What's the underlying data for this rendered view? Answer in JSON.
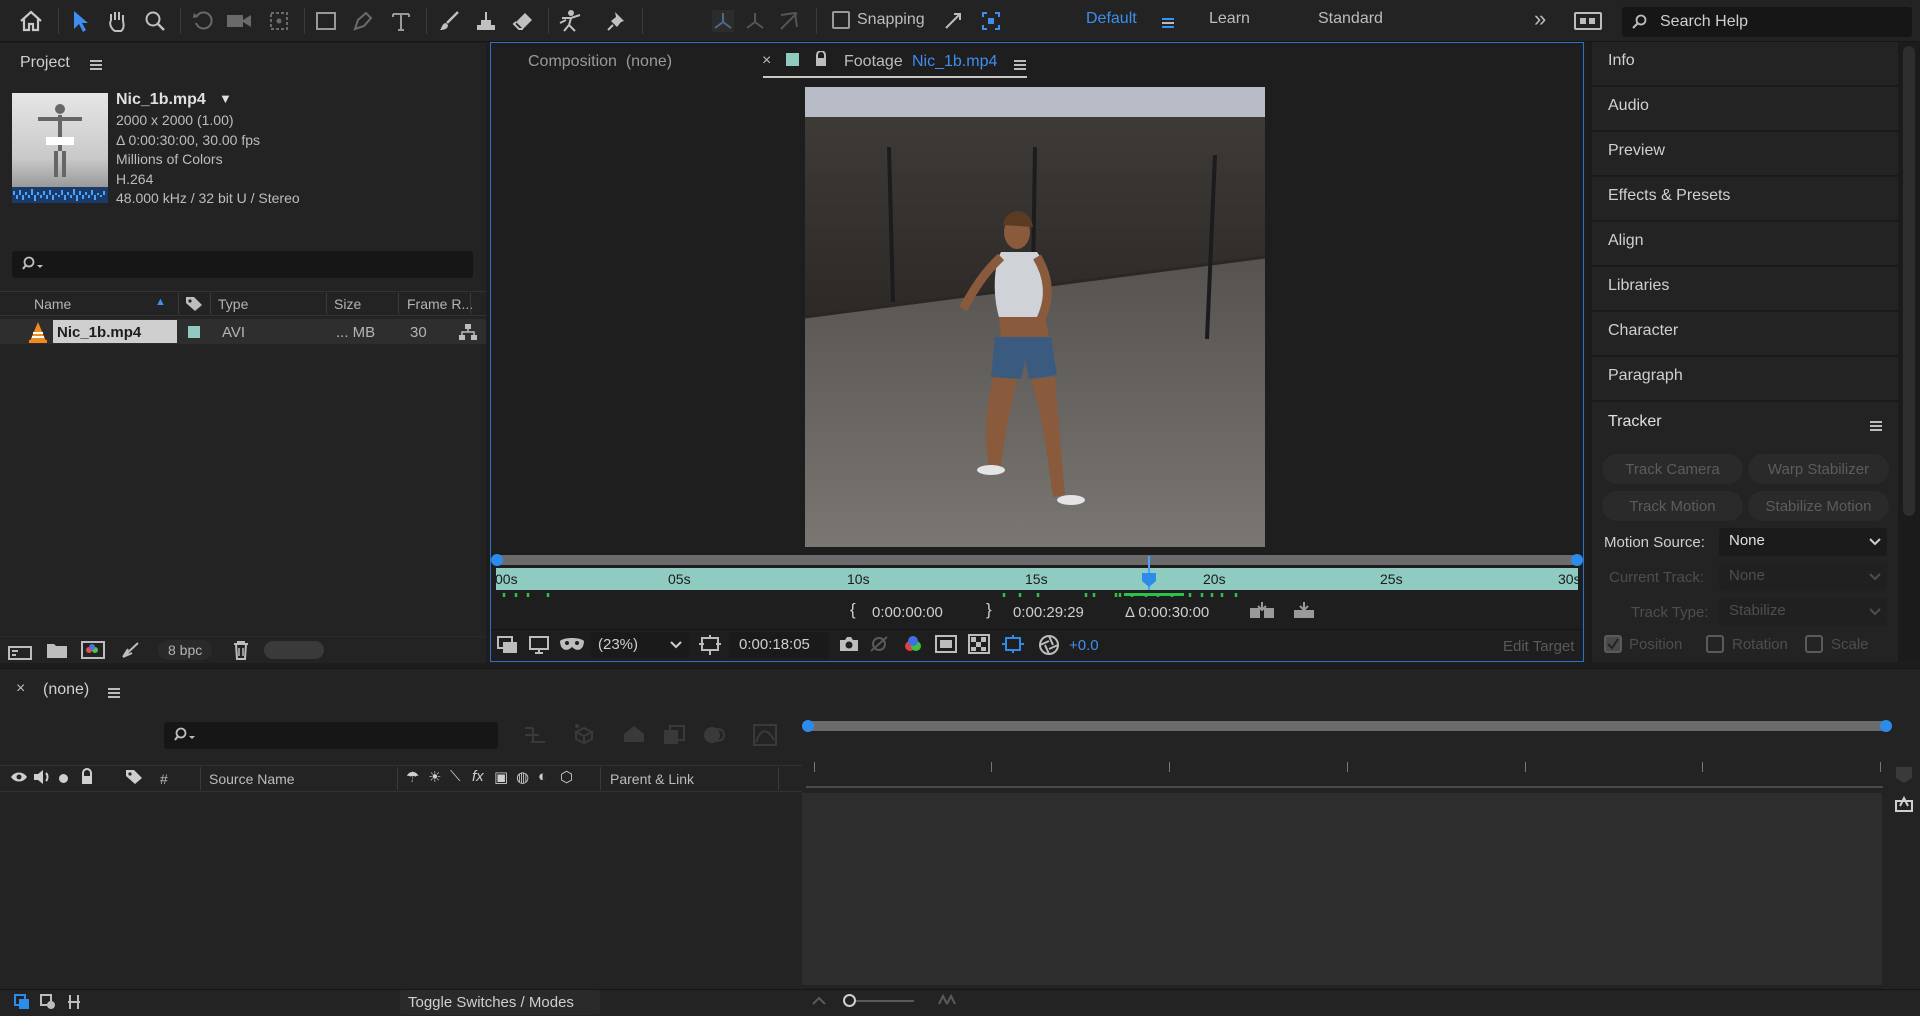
{
  "toolbar": {
    "snapping_label": "Snapping",
    "workspaces": [
      "Default",
      "Learn",
      "Standard"
    ],
    "active_workspace": "Default",
    "search_placeholder": "Search Help"
  },
  "project": {
    "panel_title": "Project",
    "item_name": "Nic_1b.mp4",
    "info_lines": [
      "2000 x 2000 (1.00)",
      "Δ 0:00:30:00, 30.00 fps",
      "Millions of Colors",
      "H.264",
      "48.000 kHz / 32 bit U / Stereo"
    ],
    "columns": [
      "Name",
      "Type",
      "Size",
      "Frame R..."
    ],
    "rows": [
      {
        "name": "Nic_1b.mp4",
        "type": "AVI",
        "size": "... MB",
        "frame_rate": "30"
      }
    ],
    "bpc": "8 bpc"
  },
  "viewer": {
    "comp_tab": "Composition  (none)",
    "footage_label": "Footage",
    "footage_name": "Nic_1b.mp4",
    "ruler_labels": [
      "00s",
      "05s",
      "10s",
      "15s",
      "20s",
      "25s",
      "30s"
    ],
    "in_point": "0:00:00:00",
    "out_point": "0:00:29:29",
    "duration": "Δ 0:00:30:00",
    "zoom": "(23%)",
    "current_time": "0:00:18:05",
    "exposure": "+0.0",
    "edit_target": "Edit Target",
    "playhead_fraction": 0.6
  },
  "right_panel": {
    "items": [
      "Info",
      "Audio",
      "Preview",
      "Effects & Presets",
      "Align",
      "Libraries",
      "Character",
      "Paragraph"
    ],
    "tracker": {
      "title": "Tracker",
      "buttons": [
        "Track Camera",
        "Warp Stabilizer",
        "Track Motion",
        "Stabilize Motion"
      ],
      "motion_source_label": "Motion Source:",
      "motion_source_value": "None",
      "current_track_label": "Current Track:",
      "current_track_value": "None",
      "track_type_label": "Track Type:",
      "track_type_value": "Stabilize",
      "checkboxes": [
        "Position",
        "Rotation",
        "Scale"
      ]
    }
  },
  "timeline": {
    "tab_title": "(none)",
    "columns": [
      "#",
      "Source Name",
      "Parent & Link"
    ],
    "toggle_label": "Toggle Switches / Modes"
  },
  "colors": {
    "accent": "#2d8ceb",
    "teal": "#8fcbc0",
    "panel": "#232323"
  }
}
